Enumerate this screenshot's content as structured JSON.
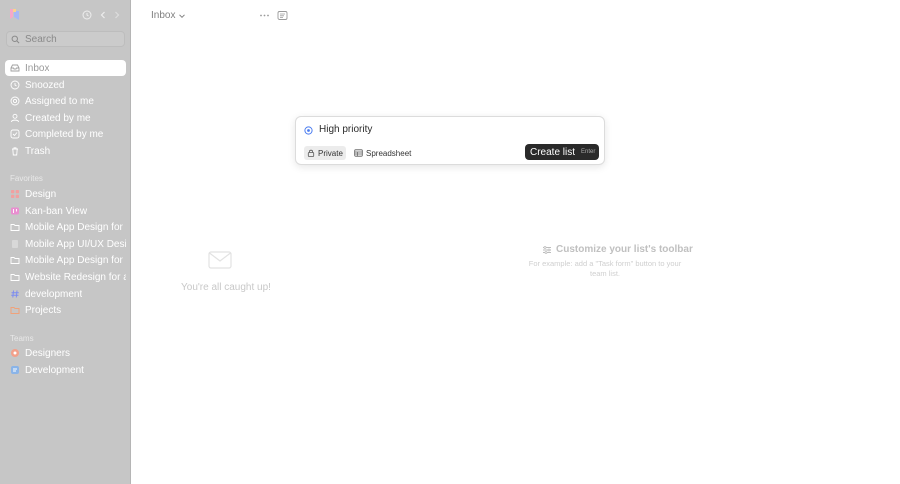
{
  "sidebar": {
    "search": {
      "placeholder": "Search"
    },
    "nav": [
      {
        "label": "Inbox",
        "icon": "inbox-icon",
        "active": true
      },
      {
        "label": "Snoozed",
        "icon": "clock-icon"
      },
      {
        "label": "Assigned to me",
        "icon": "at-icon"
      },
      {
        "label": "Created by me",
        "icon": "user-icon"
      },
      {
        "label": "Completed by me",
        "icon": "check-icon"
      },
      {
        "label": "Trash",
        "icon": "trash-icon"
      }
    ],
    "favorites_label": "Favorites",
    "favorites": [
      {
        "label": "Design",
        "icon": "grid-icon"
      },
      {
        "label": "Kan-ban View",
        "icon": "board-icon"
      },
      {
        "label": "Mobile App Design for Pr",
        "icon": "folder-icon"
      },
      {
        "label": "Mobile App UI/UX Design",
        "icon": "file-icon"
      },
      {
        "label": "Mobile App Design for Pr",
        "icon": "folder-icon"
      },
      {
        "label": "Website Redesign for a C",
        "icon": "folder-icon"
      },
      {
        "label": "development",
        "icon": "hash-icon"
      },
      {
        "label": "Projects",
        "icon": "folder-icon"
      }
    ],
    "teams_label": "Teams",
    "teams": [
      {
        "label": "Designers",
        "icon": "team-designers-icon"
      },
      {
        "label": "Development",
        "icon": "team-development-icon"
      }
    ]
  },
  "header": {
    "title": "Inbox"
  },
  "empty_state": {
    "text": "You're all caught up!"
  },
  "customize": {
    "title": "Customize your list's toolbar",
    "description": "For example: add a \"Task form\" button to your team list."
  },
  "dialog": {
    "list_name": "High priority",
    "private_label": "Private",
    "view_label": "Spreadsheet",
    "create_label": "Create list",
    "enter_hint": "Enter"
  },
  "colors": {
    "sidebar_bg": "#c6c6c6",
    "button_dark": "#2a2a2a",
    "accent_blue": "#4a7cf0"
  }
}
